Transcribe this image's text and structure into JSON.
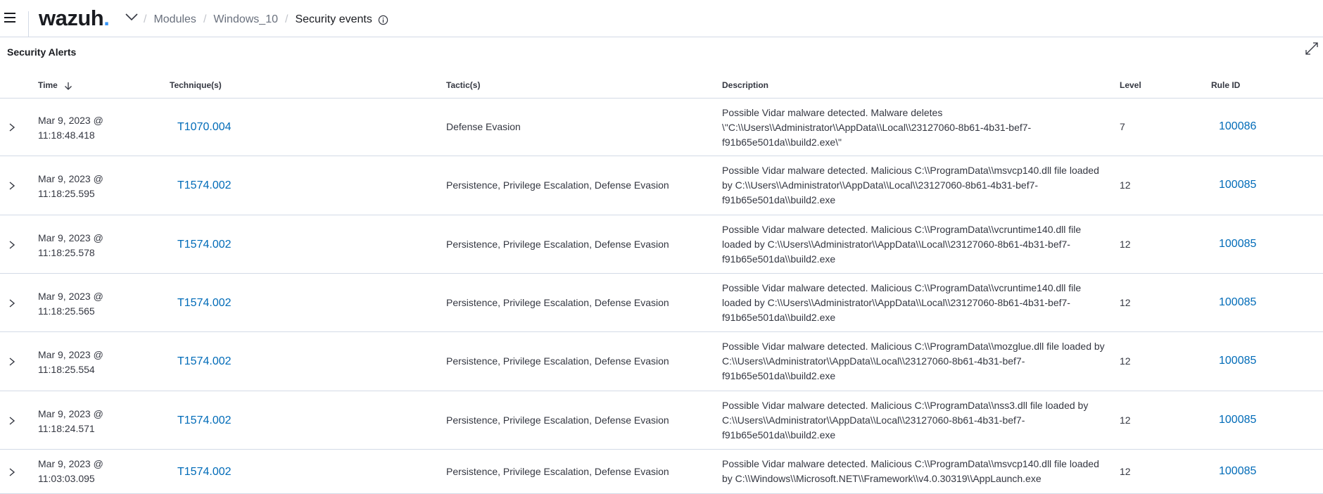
{
  "header": {
    "logo_text": "wazuh",
    "logo_dot": ".",
    "breadcrumb": [
      "Modules",
      "Windows_10",
      "Security events"
    ],
    "breadcrumb_separator": "/"
  },
  "panel": {
    "title": "Security Alerts"
  },
  "table": {
    "columns": {
      "time": "Time",
      "technique": "Technique(s)",
      "tactic": "Tactic(s)",
      "description": "Description",
      "level": "Level",
      "rule_id": "Rule ID"
    },
    "rows": [
      {
        "time_date": "Mar 9, 2023 @",
        "time_clock": "11:18:48.418",
        "technique": "T1070.004",
        "tactic": "Defense Evasion",
        "description": "Possible Vidar malware detected. Malware deletes \\\"C:\\\\Users\\\\Administrator\\\\AppData\\\\Local\\\\23127060-8b61-4b31-bef7-f91b65e501da\\\\build2.exe\\\"",
        "level": "7",
        "rule_id": "100086"
      },
      {
        "time_date": "Mar 9, 2023 @",
        "time_clock": "11:18:25.595",
        "technique": "T1574.002",
        "tactic": "Persistence, Privilege Escalation, Defense Evasion",
        "description": "Possible Vidar malware detected. Malicious C:\\\\ProgramData\\\\msvcp140.dll file loaded by C:\\\\Users\\\\Administrator\\\\AppData\\\\Local\\\\23127060-8b61-4b31-bef7-f91b65e501da\\\\build2.exe",
        "level": "12",
        "rule_id": "100085"
      },
      {
        "time_date": "Mar 9, 2023 @",
        "time_clock": "11:18:25.578",
        "technique": "T1574.002",
        "tactic": "Persistence, Privilege Escalation, Defense Evasion",
        "description": "Possible Vidar malware detected. Malicious C:\\\\ProgramData\\\\vcruntime140.dll file loaded by C:\\\\Users\\\\Administrator\\\\AppData\\\\Local\\\\23127060-8b61-4b31-bef7-f91b65e501da\\\\build2.exe",
        "level": "12",
        "rule_id": "100085"
      },
      {
        "time_date": "Mar 9, 2023 @",
        "time_clock": "11:18:25.565",
        "technique": "T1574.002",
        "tactic": "Persistence, Privilege Escalation, Defense Evasion",
        "description": "Possible Vidar malware detected. Malicious C:\\\\ProgramData\\\\vcruntime140.dll file loaded by C:\\\\Users\\\\Administrator\\\\AppData\\\\Local\\\\23127060-8b61-4b31-bef7-f91b65e501da\\\\build2.exe",
        "level": "12",
        "rule_id": "100085"
      },
      {
        "time_date": "Mar 9, 2023 @",
        "time_clock": "11:18:25.554",
        "technique": "T1574.002",
        "tactic": "Persistence, Privilege Escalation, Defense Evasion",
        "description": "Possible Vidar malware detected. Malicious C:\\\\ProgramData\\\\mozglue.dll file loaded by C:\\\\Users\\\\Administrator\\\\AppData\\\\Local\\\\23127060-8b61-4b31-bef7-f91b65e501da\\\\build2.exe",
        "level": "12",
        "rule_id": "100085"
      },
      {
        "time_date": "Mar 9, 2023 @",
        "time_clock": "11:18:24.571",
        "technique": "T1574.002",
        "tactic": "Persistence, Privilege Escalation, Defense Evasion",
        "description": "Possible Vidar malware detected. Malicious C:\\\\ProgramData\\\\nss3.dll file loaded by C:\\\\Users\\\\Administrator\\\\AppData\\\\Local\\\\23127060-8b61-4b31-bef7-f91b65e501da\\\\build2.exe",
        "level": "12",
        "rule_id": "100085"
      },
      {
        "time_date": "Mar 9, 2023 @",
        "time_clock": "11:03:03.095",
        "technique": "T1574.002",
        "tactic": "Persistence, Privilege Escalation, Defense Evasion",
        "description": "Possible Vidar malware detected. Malicious C:\\\\ProgramData\\\\msvcp140.dll file loaded by C:\\\\Windows\\\\Microsoft.NET\\\\Framework\\\\v4.0.30319\\\\AppLaunch.exe",
        "level": "12",
        "rule_id": "100085"
      }
    ]
  },
  "icons": {
    "menu": "hamburger-icon",
    "logo_menu": "chevron-down-icon",
    "breadcrumb_info": "info-icon",
    "fullscreen": "expand-icon",
    "sort": "arrow-down-icon",
    "row_expand": "chevron-right-icon"
  },
  "colors": {
    "link": "#006bb8",
    "logo_dot": "#3595f9",
    "border": "#d3dae6",
    "text": "#343741"
  }
}
